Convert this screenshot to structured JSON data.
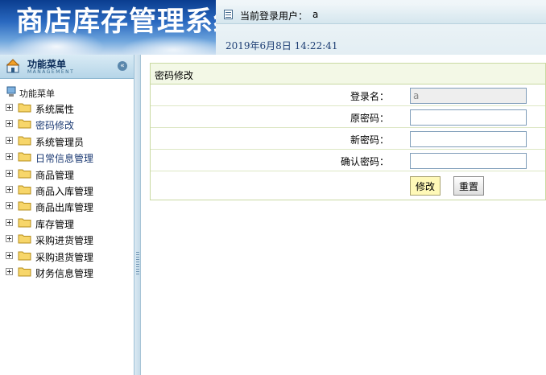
{
  "banner": {
    "title": "商店库存管理系统"
  },
  "topbar": {
    "current_user_label": "当前登录用户：",
    "current_user": "a",
    "datetime": "2019年6月8日   14:22:41"
  },
  "sidebar": {
    "header_title": "功能菜单",
    "header_sub": "MANAGEMENT",
    "tree_root": "功能菜单",
    "items": [
      {
        "label": "系统属性"
      },
      {
        "label": "密码修改"
      },
      {
        "label": "系统管理员"
      },
      {
        "label": "日常信息管理"
      },
      {
        "label": "商品管理"
      },
      {
        "label": "商品入库管理"
      },
      {
        "label": "商品出库管理"
      },
      {
        "label": "库存管理"
      },
      {
        "label": "采购进货管理"
      },
      {
        "label": "采购退货管理"
      },
      {
        "label": "财务信息管理"
      }
    ]
  },
  "form": {
    "heading": "密码修改",
    "login_label": "登录名：",
    "login_value": "a",
    "old_label": "原密码：",
    "old_value": "",
    "new_label": "新密码：",
    "new_value": "",
    "confirm_label": "确认密码：",
    "confirm_value": "",
    "submit_label": "修改",
    "reset_label": "重置"
  },
  "colors": {
    "banner_blue": "#2a69c0",
    "form_header": "#f3f8e6",
    "submit_bg": "#fff9b8"
  }
}
